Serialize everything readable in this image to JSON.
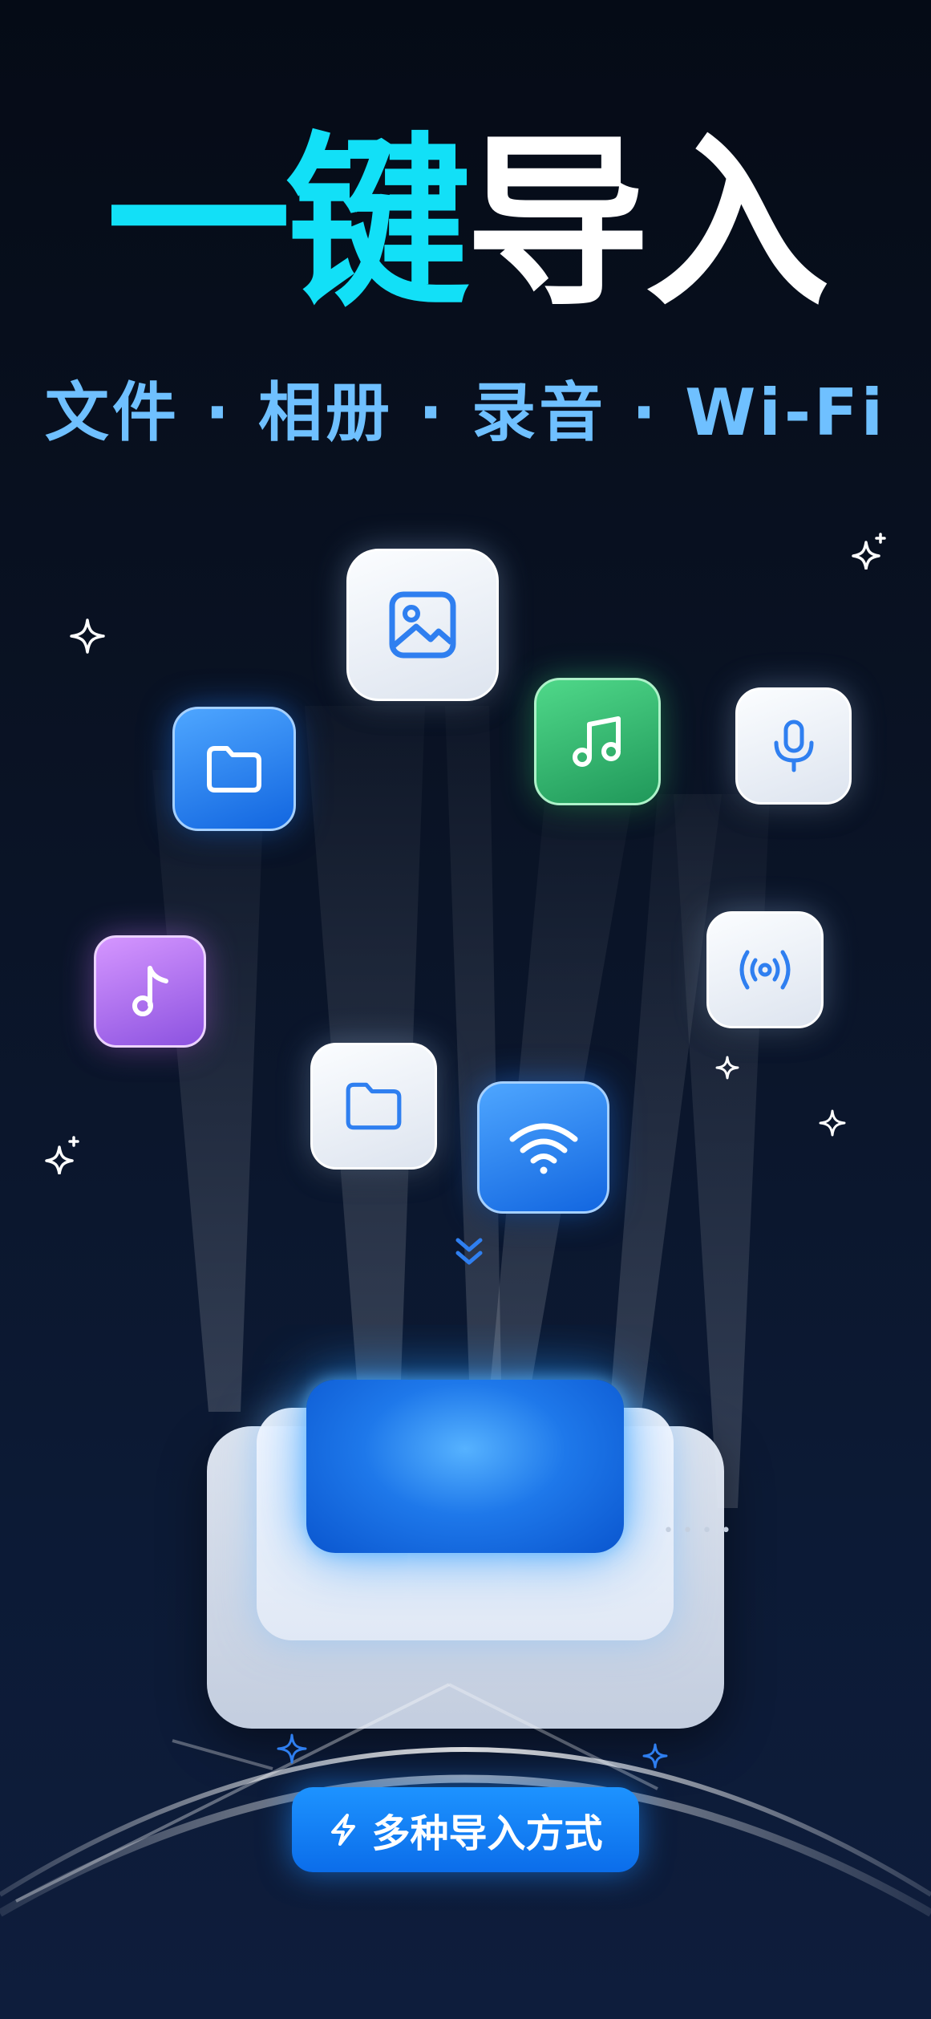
{
  "title": {
    "accent": "一键",
    "rest": "导入"
  },
  "subtitle": "文件 · 相册 · 录音 · Wi-Fi",
  "tiles": [
    {
      "name": "photo-icon",
      "style": "light"
    },
    {
      "name": "folder-icon",
      "style": "blue"
    },
    {
      "name": "music-icon",
      "style": "green"
    },
    {
      "name": "microphone-icon",
      "style": "light"
    },
    {
      "name": "music-note-icon",
      "style": "purple"
    },
    {
      "name": "broadcast-icon",
      "style": "light"
    },
    {
      "name": "folder-icon",
      "style": "light"
    },
    {
      "name": "wifi-icon",
      "style": "blue"
    }
  ],
  "scroll_hint_icon": "chevrons-down-icon",
  "cta": {
    "label": "多种导入方式",
    "icon": "lightning-icon"
  },
  "colors": {
    "accent_cyan": "#12e0f7",
    "subtitle_blue": "#6fc0ff",
    "button_blue": "#0b6dea",
    "background": "#0a1325"
  }
}
